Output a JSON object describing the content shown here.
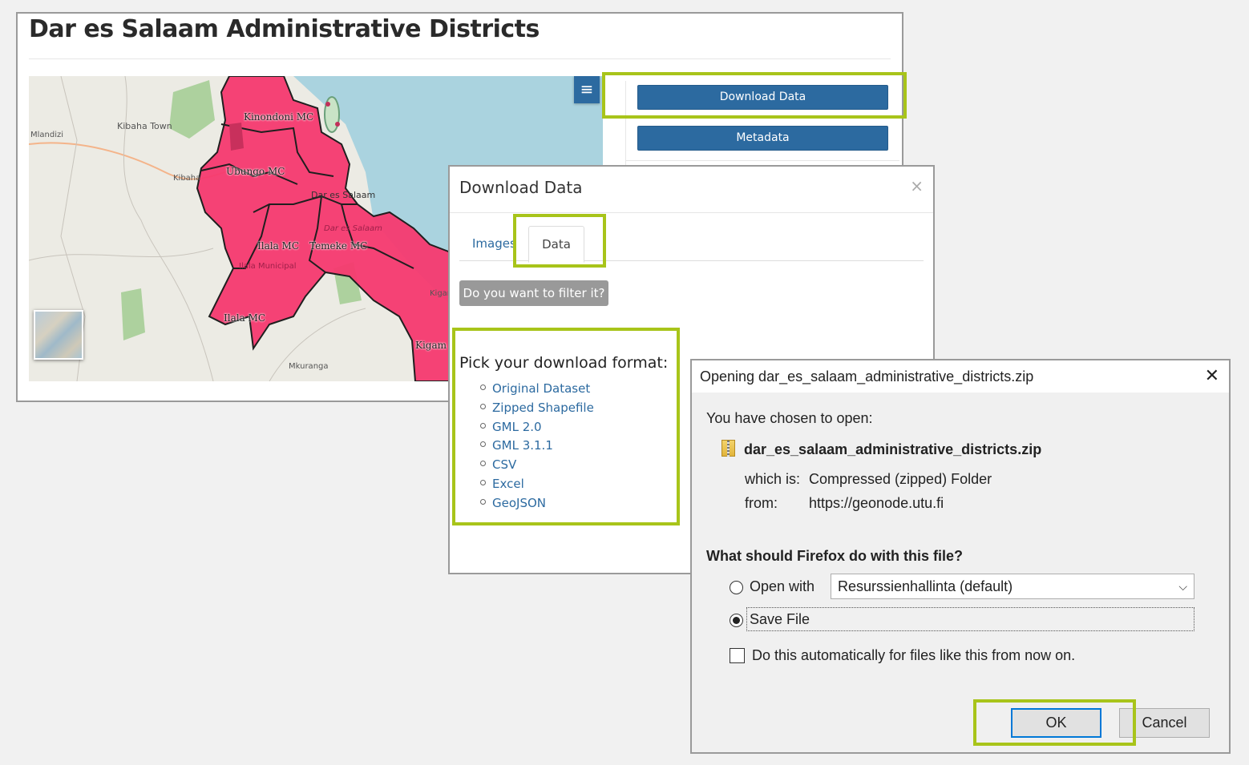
{
  "page": {
    "title": "Dar es Salaam Administrative Districts"
  },
  "map": {
    "district_labels": [
      "Kinondoni MC",
      "Ubungo MC",
      "Ilala MC",
      "Temeke MC",
      "Ilala MC"
    ],
    "place_labels": [
      "Mlandizi",
      "Kibaha Town",
      "Kibaha",
      "Dar es Salaam",
      "Dar es Salaam",
      "Ilala Municipal",
      "Mkuranga",
      "Kigamboni",
      "Kigam"
    ],
    "district_color": "#f5396f",
    "water_color": "#aad3df",
    "layer_menu_icon": "hamburger-icon",
    "basemap_icon": "basemap-thumbnail-icon"
  },
  "sidebar": {
    "download_label": "Download Data",
    "metadata_label": "Metadata",
    "button_color": "#2c6aa0"
  },
  "download_modal": {
    "title": "Download Data",
    "close": "×",
    "tabs": [
      "Images",
      "Data"
    ],
    "active_tab": "Data",
    "filter_label": "Do you want to filter it?",
    "format_heading": "Pick your download format:",
    "formats": [
      "Original Dataset",
      "Zipped Shapefile",
      "GML 2.0",
      "GML 3.1.1",
      "CSV",
      "Excel",
      "GeoJSON"
    ]
  },
  "firefox_dialog": {
    "title": "Opening dar_es_salaam_administrative_districts.zip",
    "close": "✕",
    "chosen_text": "You have chosen to open:",
    "filename": "dar_es_salaam_administrative_districts.zip",
    "which_is_label": "which is:",
    "which_is_value": "Compressed (zipped) Folder",
    "from_label": "from:",
    "from_value": "https://geonode.utu.fi",
    "question": "What should Firefox do with this file?",
    "open_with_label": "Open with",
    "open_with_app": "Resurssienhallinta (default)",
    "save_file_label": "Save File",
    "selected_option": "Save File",
    "auto_label": "Do this automatically for files like this from now on.",
    "auto_checked": false,
    "ok_label": "OK",
    "cancel_label": "Cancel"
  },
  "highlight_color": "#a8c41a"
}
